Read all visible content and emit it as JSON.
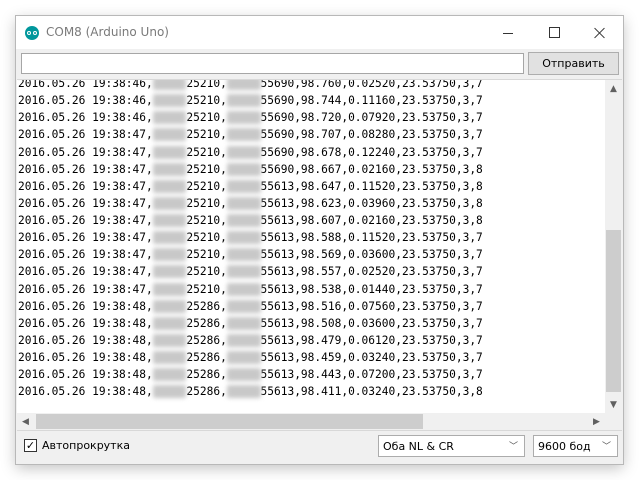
{
  "window": {
    "title": "COM8 (Arduino Uno)",
    "controls": {
      "minimize_icon": "minimize-icon",
      "maximize_icon": "maximize-icon",
      "close_icon": "close-icon"
    }
  },
  "send_bar": {
    "input_value": "",
    "send_label": "Отправить"
  },
  "output": {
    "lines": [
      {
        "ts": "2016.05.26 19:38:46,",
        "a": "25210,",
        "b": "55690,98.760,0.02520,23.53750,3,7"
      },
      {
        "ts": "2016.05.26 19:38:46,",
        "a": "25210,",
        "b": "55690,98.744,0.11160,23.53750,3,7"
      },
      {
        "ts": "2016.05.26 19:38:46,",
        "a": "25210,",
        "b": "55690,98.720,0.07920,23.53750,3,7"
      },
      {
        "ts": "2016.05.26 19:38:47,",
        "a": "25210,",
        "b": "55690,98.707,0.08280,23.53750,3,7"
      },
      {
        "ts": "2016.05.26 19:38:47,",
        "a": "25210,",
        "b": "55690,98.678,0.12240,23.53750,3,7"
      },
      {
        "ts": "2016.05.26 19:38:47,",
        "a": "25210,",
        "b": "55690,98.667,0.02160,23.53750,3,8"
      },
      {
        "ts": "2016.05.26 19:38:47,",
        "a": "25210,",
        "b": "55613,98.647,0.11520,23.53750,3,8"
      },
      {
        "ts": "2016.05.26 19:38:47,",
        "a": "25210,",
        "b": "55613,98.623,0.03960,23.53750,3,8"
      },
      {
        "ts": "2016.05.26 19:38:47,",
        "a": "25210,",
        "b": "55613,98.607,0.02160,23.53750,3,8"
      },
      {
        "ts": "2016.05.26 19:38:47,",
        "a": "25210,",
        "b": "55613,98.588,0.11520,23.53750,3,7"
      },
      {
        "ts": "2016.05.26 19:38:47,",
        "a": "25210,",
        "b": "55613,98.569,0.03600,23.53750,3,7"
      },
      {
        "ts": "2016.05.26 19:38:47,",
        "a": "25210,",
        "b": "55613,98.557,0.02520,23.53750,3,7"
      },
      {
        "ts": "2016.05.26 19:38:47,",
        "a": "25210,",
        "b": "55613,98.538,0.01440,23.53750,3,7"
      },
      {
        "ts": "2016.05.26 19:38:48,",
        "a": "25286,",
        "b": "55613,98.516,0.07560,23.53750,3,7"
      },
      {
        "ts": "2016.05.26 19:38:48,",
        "a": "25286,",
        "b": "55613,98.508,0.03600,23.53750,3,7"
      },
      {
        "ts": "2016.05.26 19:38:48,",
        "a": "25286,",
        "b": "55613,98.479,0.06120,23.53750,3,7"
      },
      {
        "ts": "2016.05.26 19:38:48,",
        "a": "25286,",
        "b": "55613,98.459,0.03240,23.53750,3,7"
      },
      {
        "ts": "2016.05.26 19:38:48,",
        "a": "25286,",
        "b": "55613,98.443,0.07200,23.53750,3,7"
      },
      {
        "ts": "2016.05.26 19:38:48,",
        "a": "25286,",
        "b": "55613,98.411,0.03240,23.53750,3,8"
      }
    ]
  },
  "bottom": {
    "autoscroll_label": "Автопрокрутка",
    "autoscroll_checked": "✓",
    "line_ending": "Оба NL & CR",
    "baud_rate": "9600 бод"
  }
}
